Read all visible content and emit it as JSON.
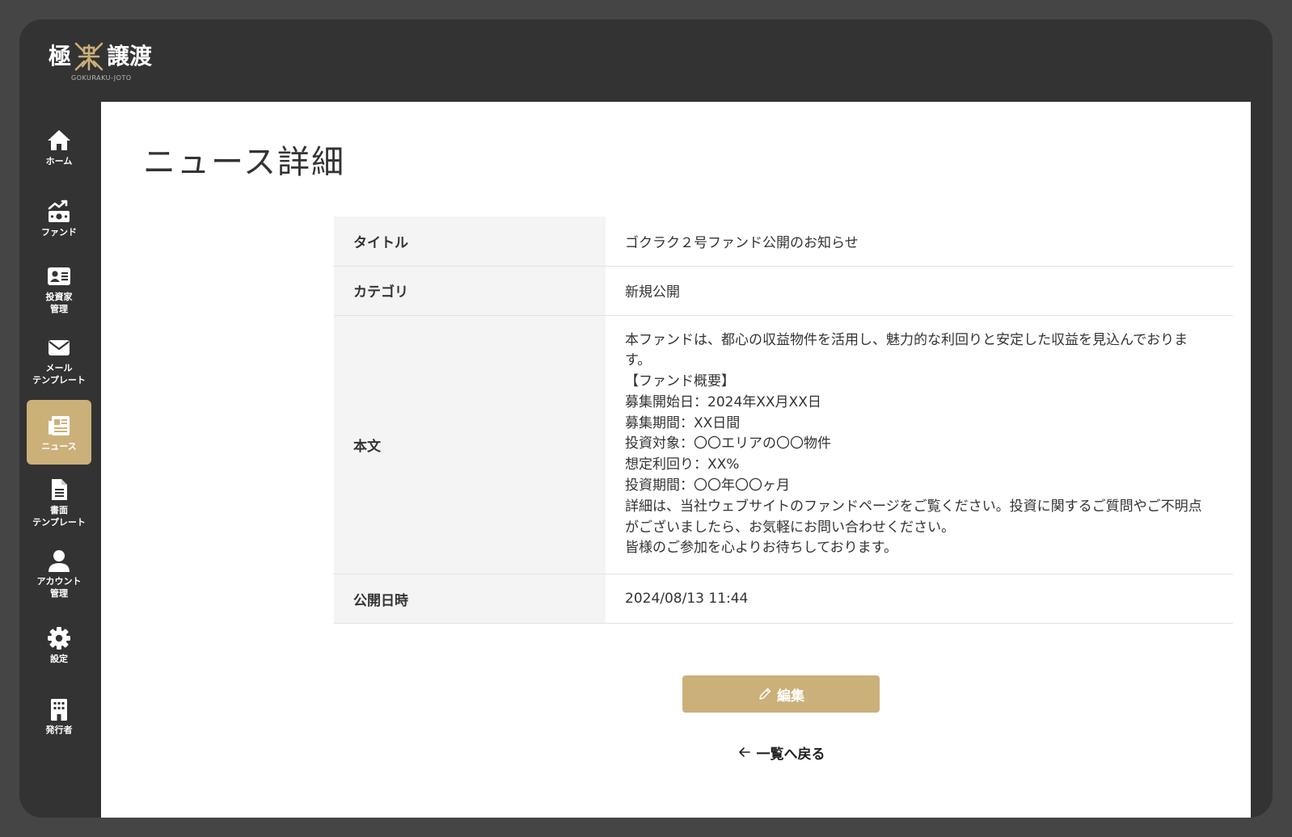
{
  "app": {
    "logo_left": "極",
    "logo_right": "譲渡",
    "logo_sub": "GOKURAKU-JOTO",
    "accent_color": "#cbb07a"
  },
  "sidebar": {
    "items": [
      {
        "label": "ホーム",
        "icon": "home-icon"
      },
      {
        "label": "ファンド",
        "icon": "fund-icon"
      },
      {
        "label": "投資家\n管理",
        "icon": "investor-card-icon"
      },
      {
        "label": "メール\nテンプレート",
        "icon": "mail-icon"
      },
      {
        "label": "ニュース",
        "icon": "newspaper-icon",
        "active": true
      },
      {
        "label": "書面\nテンプレート",
        "icon": "document-icon"
      },
      {
        "label": "アカウント\n管理",
        "icon": "user-icon"
      },
      {
        "label": "設定",
        "icon": "gear-icon"
      },
      {
        "label": "発行者",
        "icon": "building-icon"
      }
    ]
  },
  "page": {
    "title": "ニュース詳細"
  },
  "detail": {
    "rows": [
      {
        "label": "タイトル",
        "value": "ゴクラク２号ファンド公開のお知らせ"
      },
      {
        "label": "カテゴリ",
        "value": "新規公開"
      },
      {
        "label": "本文",
        "value": "本ファンドは、都心の収益物件を活用し、魅力的な利回りと安定した収益を見込んでおります。\n【ファンド概要】\n募集開始日：2024年XX月XX日\n募集期間：XX日間\n投資対象：〇〇エリアの〇〇物件\n想定利回り：XX%\n投資期間：〇〇年〇〇ヶ月\n詳細は、当社ウェブサイトのファンドページをご覧ください。投資に関するご質問やご不明点\nがございましたら、お気軽にお問い合わせください。\n皆様のご参加を心よりお待ちしております。"
      },
      {
        "label": "公開日時",
        "value": "2024/08/13 11:44"
      }
    ]
  },
  "actions": {
    "edit_label": "編集",
    "back_label": "一覧へ戻る"
  }
}
